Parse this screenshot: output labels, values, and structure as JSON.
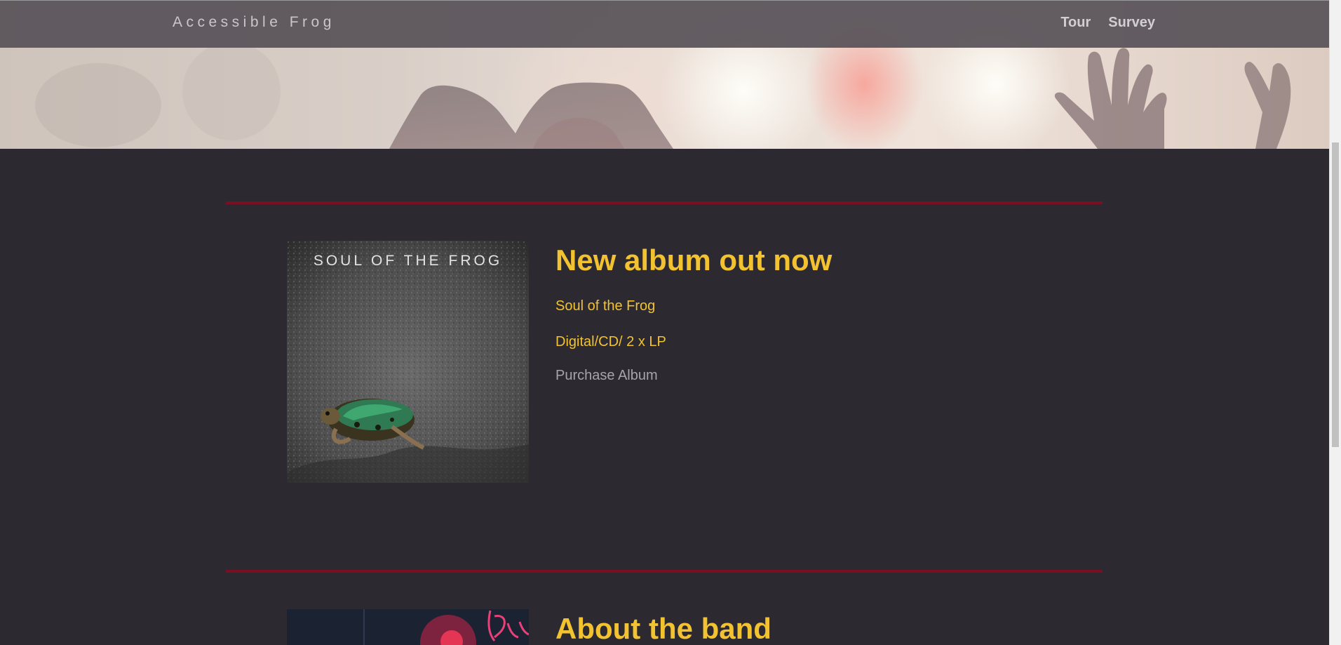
{
  "navbar": {
    "brand": "Accessible Frog",
    "links": [
      {
        "label": "Tour"
      },
      {
        "label": "Survey"
      }
    ]
  },
  "album_section": {
    "heading": "New album out now",
    "cover_title": "SOUL OF THE FROG",
    "album_title": "Soul of the Frog",
    "formats": "Digital/CD/ 2 x LP",
    "purchase_label": "Purchase Album"
  },
  "band_section": {
    "heading": "About the band"
  },
  "colors": {
    "background": "#2c2a30",
    "accent": "#f2c230",
    "divider": "#7a0f24",
    "link_muted": "#a7a4a8"
  }
}
